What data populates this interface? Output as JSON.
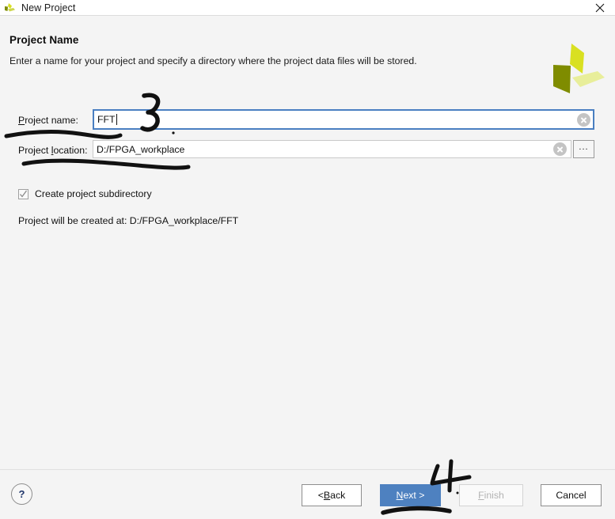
{
  "window": {
    "title": "New Project",
    "app_icon": "vivado-logo-icon",
    "close_icon": "close-icon"
  },
  "page": {
    "title": "Project Name",
    "subtitle": "Enter a name for your project and specify a directory where the project data files will be stored.",
    "brand_logo": "xilinx-vivado-logo"
  },
  "form": {
    "project_name": {
      "label_pre": "P",
      "label_post": "roject name:",
      "value": "FFT",
      "clear_icon": "clear-x-icon",
      "focused": true
    },
    "project_location": {
      "label_pre": "Project ",
      "label_mnem": "l",
      "label_post": "ocation:",
      "value": "D:/FPGA_workplace",
      "clear_icon": "clear-x-icon",
      "browse_label": "...",
      "browse_icon": "ellipsis-browse-icon"
    },
    "create_subdirectory": {
      "label": "Create project subdirectory",
      "checked": true,
      "check_icon": "checkmark-icon"
    },
    "created_at_text": "Project will be created at: D:/FPGA_workplace/FFT"
  },
  "footer": {
    "help_label": "?",
    "help_icon": "question-mark-icon",
    "buttons": {
      "back": {
        "pre": "< ",
        "mnem": "B",
        "post": "ack",
        "enabled": true
      },
      "next": {
        "pre": "",
        "mnem": "N",
        "post": "ext >",
        "enabled": true,
        "default": true
      },
      "finish": {
        "pre": "",
        "mnem": "F",
        "post": "inish",
        "enabled": false
      },
      "cancel": {
        "pre": "",
        "mnem": "",
        "post": "Cancel",
        "enabled": true
      }
    }
  },
  "annotations": {
    "marker_color": "#111111",
    "items": [
      {
        "name": "handwritten-digit-3",
        "text": "3"
      },
      {
        "name": "handwritten-digit-4",
        "text": "4"
      },
      {
        "name": "underline-project-name-label"
      },
      {
        "name": "underline-project-location-label"
      },
      {
        "name": "underline-next-button"
      }
    ]
  },
  "colors": {
    "accent_blue": "#4e81c0",
    "focus_border": "#4a7fc1",
    "dialog_bg": "#f4f4f4",
    "logo_dark": "#7f8c00",
    "logo_mid": "#d9e021",
    "logo_light": "#e8ee9a"
  }
}
